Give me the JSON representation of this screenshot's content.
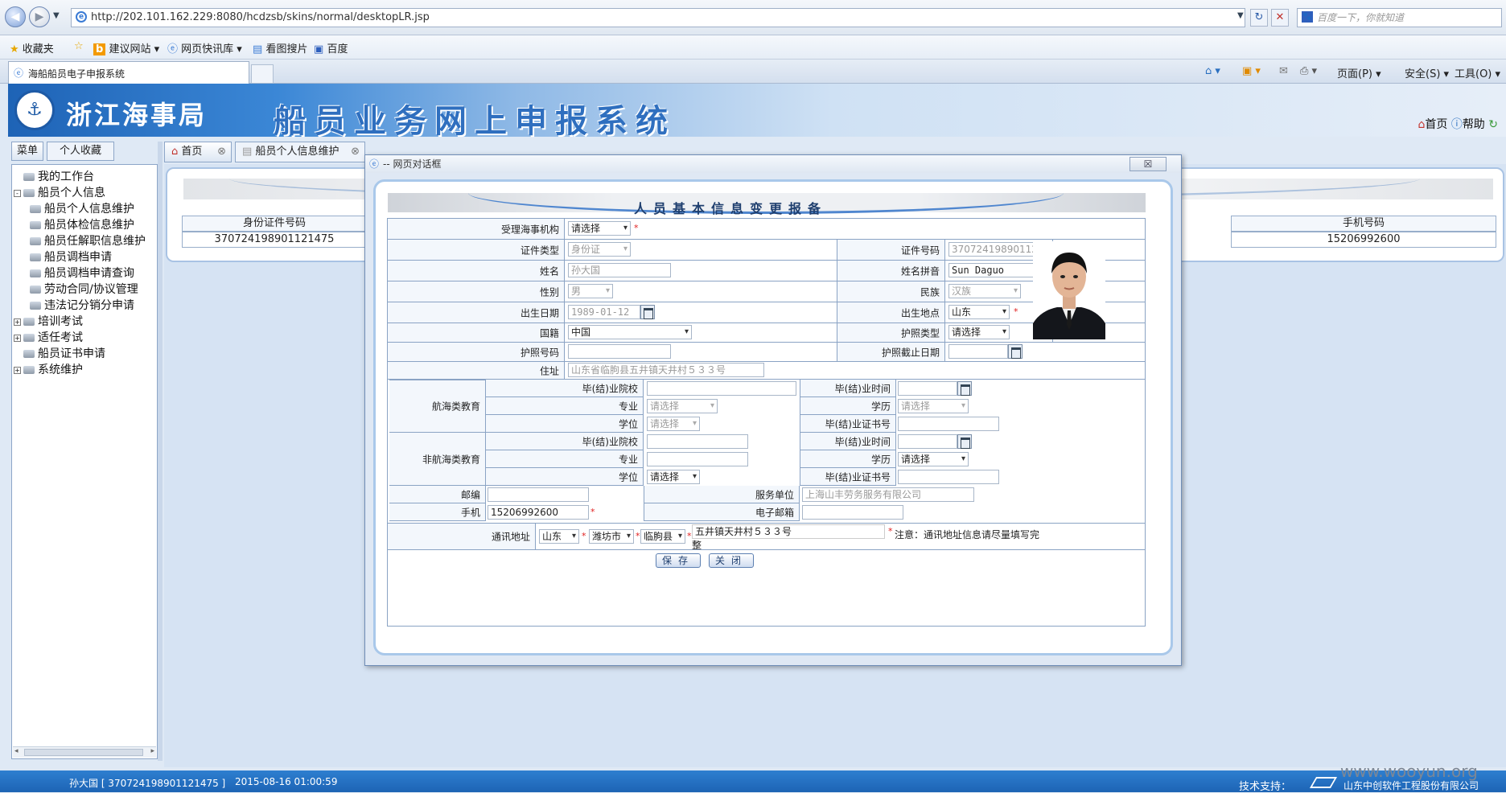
{
  "browser": {
    "url": "http://202.101.162.229:8080/hcdzsb/skins/normal/desktopLR.jsp",
    "search_placeholder": "百度一下，你就知道",
    "favorites": [
      "收藏夹",
      "建议网站",
      "网页快讯库",
      "看图搜片",
      "百度"
    ],
    "tab_title": "海船船员电子申报系统",
    "commands": [
      "页面(P)",
      "安全(S)",
      "工具(O)"
    ]
  },
  "app": {
    "org_name": "浙江海事局",
    "system_name": "船员业务网上申报系统",
    "home_link": "首页",
    "help_link": "帮助"
  },
  "left_panel": {
    "tabs": [
      "菜单",
      "个人收藏"
    ],
    "tree": [
      {
        "label": "我的工作台",
        "level": 1,
        "expander": ""
      },
      {
        "label": "船员个人信息",
        "level": 1,
        "expander": "-"
      },
      {
        "label": "船员个人信息维护",
        "level": 2,
        "expander": ""
      },
      {
        "label": "船员体检信息维护",
        "level": 2,
        "expander": ""
      },
      {
        "label": "船员任解职信息维护",
        "level": 2,
        "expander": ""
      },
      {
        "label": "船员调档申请",
        "level": 2,
        "expander": ""
      },
      {
        "label": "船员调档申请查询",
        "level": 2,
        "expander": ""
      },
      {
        "label": "劳动合同/协议管理",
        "level": 2,
        "expander": ""
      },
      {
        "label": "违法记分销分申请",
        "level": 2,
        "expander": ""
      },
      {
        "label": "培训考试",
        "level": 1,
        "expander": "+"
      },
      {
        "label": "适任考试",
        "level": 1,
        "expander": "+"
      },
      {
        "label": "船员证书申请",
        "level": 1,
        "expander": ""
      },
      {
        "label": "系统维护",
        "level": 1,
        "expander": "+"
      }
    ]
  },
  "content": {
    "tabs": [
      "首页",
      "船员个人信息维护"
    ],
    "grid": {
      "col_idnum": "身份证件号码",
      "col_phone": "手机号码",
      "row_idnum": "370724198901121475",
      "row_phone": "15206992600"
    }
  },
  "dialog": {
    "title": "-- 网页对话框",
    "form_title": "人员基本信息变更报备",
    "labels": {
      "agency": "受理海事机构",
      "id_type": "证件类型",
      "id_no": "证件号码",
      "name": "姓名",
      "name_pinyin": "姓名拼音",
      "gender": "性别",
      "ethnicity": "民族",
      "birth_date": "出生日期",
      "birth_place": "出生地点",
      "nationality": "国籍",
      "passport_type": "护照类型",
      "passport_no": "护照号码",
      "passport_expiry": "护照截止日期",
      "address": "住址",
      "maritime_edu": "航海类教育",
      "non_maritime_edu": "非航海类教育",
      "grad_school": "毕(结)业院校",
      "grad_time": "毕(结)业时间",
      "major": "专业",
      "edu_level": "学历",
      "degree": "学位",
      "grad_cert_no": "毕(结)业证书号",
      "postcode": "邮编",
      "employer": "服务单位",
      "mobile": "手机",
      "email": "电子邮箱",
      "mail_address": "通讯地址"
    },
    "values": {
      "agency": "请选择",
      "id_type": "身份证",
      "id_no": "370724198901121475",
      "name": "孙大国",
      "name_pinyin": "Sun Daguo",
      "gender": "男",
      "ethnicity": "汉族",
      "birth_date": "1989-01-12",
      "birth_place": "山东",
      "nationality": "中国",
      "passport_type": "请选择",
      "passport_no": "",
      "passport_expiry": "",
      "address": "山东省临朐县五井镇天井村５３３号",
      "m_grad_school": "",
      "m_grad_time": "",
      "m_major": "请选择",
      "m_edu_level": "请选择",
      "m_degree": "请选择",
      "m_grad_cert_no": "",
      "n_grad_school": "",
      "n_grad_time": "",
      "n_major": "",
      "n_edu_level": "请选择",
      "n_degree": "请选择",
      "n_grad_cert_no": "",
      "postcode": "",
      "employer": "上海山丰劳务服务有限公司",
      "mobile": "15206992600",
      "email": "",
      "mail_province": "山东",
      "mail_city": "潍坊市",
      "mail_county": "临朐县",
      "mail_detail": "五井镇天井村５３３号",
      "mail_detail_wrap": "整",
      "mail_note": "注意：通讯地址信息请尽量填写完"
    },
    "buttons": {
      "save": "保存",
      "close": "关闭"
    }
  },
  "status_bar": {
    "user": "孙大国 [ 370724198901121475 ]",
    "datetime": "2015-08-16 01:00:59",
    "support_label": "技术支持：",
    "support_company": "山东中创软件工程股份有限公司",
    "watermark": "www.wooyun.org"
  },
  "colors": {
    "accent": "#1d64b4",
    "required": "#e02020"
  }
}
